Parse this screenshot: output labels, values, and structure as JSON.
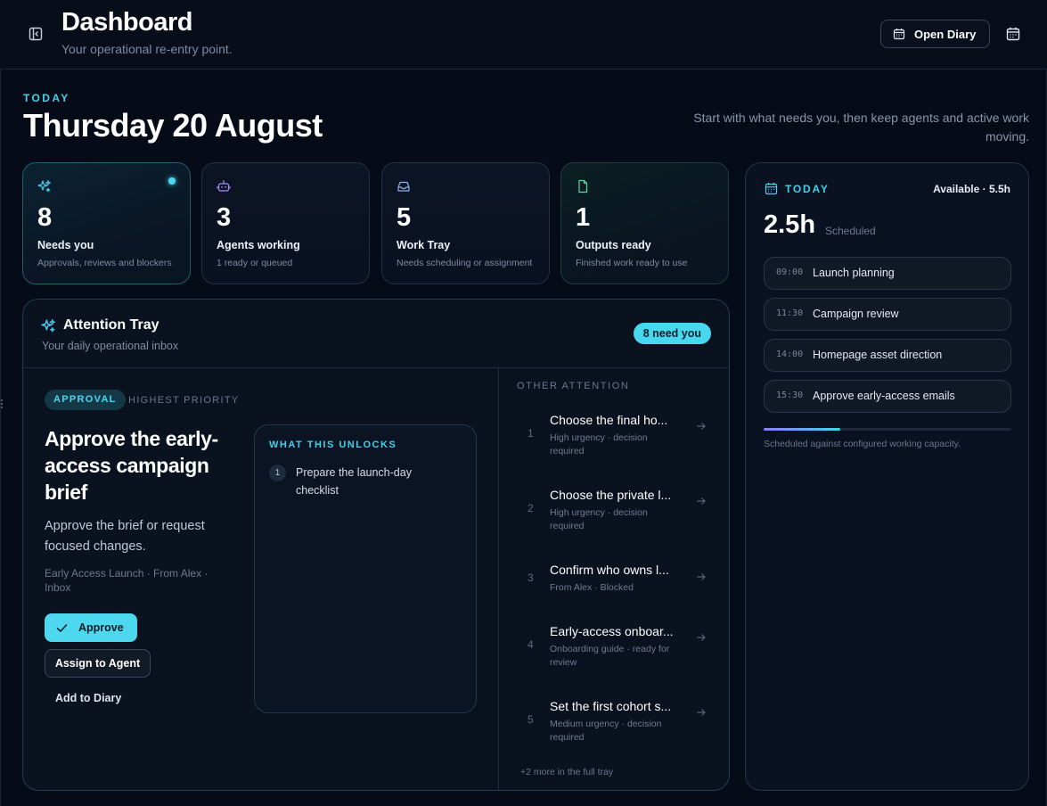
{
  "header": {
    "title": "Dashboard",
    "subtitle": "Your operational re-entry point.",
    "open_diary_label": "Open Diary"
  },
  "today": {
    "kicker": "TODAY",
    "date": "Thursday 20 August",
    "intro": "Start with what needs you, then keep agents and active work moving."
  },
  "stats": [
    {
      "count": "8",
      "label": "Needs you",
      "desc": "Approvals, reviews and blockers",
      "icon": "sparkles-icon"
    },
    {
      "count": "3",
      "label": "Agents working",
      "desc": "1 ready or queued",
      "icon": "bot-icon"
    },
    {
      "count": "5",
      "label": "Work Tray",
      "desc": "Needs scheduling or assignment",
      "icon": "inbox-icon"
    },
    {
      "count": "1",
      "label": "Outputs ready",
      "desc": "Finished work ready to use",
      "icon": "file-icon"
    }
  ],
  "tray": {
    "title": "Attention Tray",
    "subtitle": "Your daily operational inbox",
    "badge": "8 need you",
    "focus": {
      "tag": "APPROVAL",
      "priority": "HIGHEST PRIORITY",
      "title": "Approve the early-access campaign brief",
      "description": "Approve the brief or request focused changes.",
      "meta": "Early Access Launch · From Alex · Inbox",
      "approve_label": "Approve",
      "assign_label": "Assign to Agent",
      "diary_label": "Add to Diary",
      "unlocks_kicker": "WHAT THIS UNLOCKS",
      "unlocks": [
        {
          "num": "1",
          "text": "Prepare the launch-day checklist"
        }
      ]
    },
    "other_kicker": "OTHER ATTENTION",
    "other": [
      {
        "num": "1",
        "title": "Choose the final ho...",
        "meta": "High urgency · decision required"
      },
      {
        "num": "2",
        "title": "Choose the private l...",
        "meta": "High urgency · decision required"
      },
      {
        "num": "3",
        "title": "Confirm who owns l...",
        "meta": "From Alex · Blocked"
      },
      {
        "num": "4",
        "title": "Early-access onboar...",
        "meta": "Onboarding guide · ready for review"
      },
      {
        "num": "5",
        "title": "Set the first cohort s...",
        "meta": "Medium urgency · decision required"
      }
    ],
    "more": "+2 more in the full tray"
  },
  "schedule": {
    "kicker": "TODAY",
    "available": "Available · 5.5h",
    "hours": "2.5h",
    "hours_label": "Scheduled",
    "slots": [
      {
        "time": "09:00",
        "title": "Launch planning"
      },
      {
        "time": "11:30",
        "title": "Campaign review"
      },
      {
        "time": "14:00",
        "title": "Homepage asset direction"
      },
      {
        "time": "15:30",
        "title": "Approve early-access emails"
      }
    ],
    "capacity_fraction": 0.31,
    "capacity_note": "Scheduled against configured working capacity."
  },
  "colors": {
    "accent": "#47d7ef",
    "background": "#060c17"
  }
}
